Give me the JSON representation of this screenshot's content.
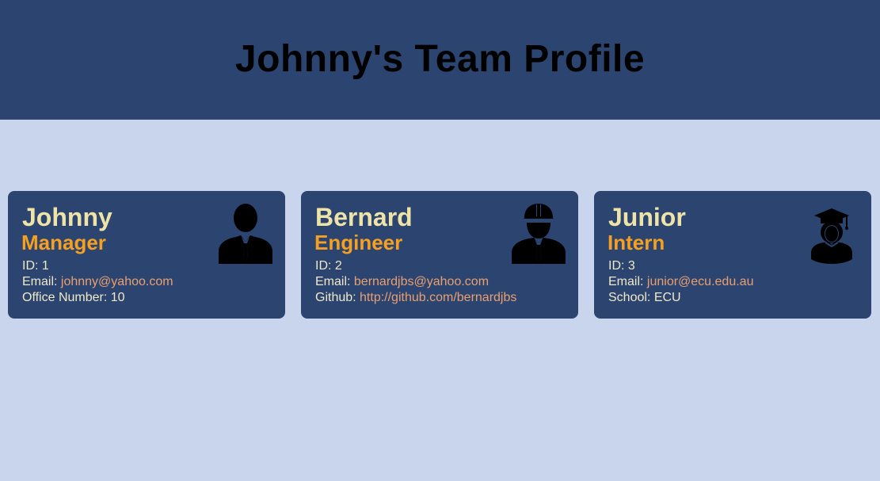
{
  "header": {
    "title": "Johnny's Team Profile"
  },
  "cards": [
    {
      "name": "Johnny",
      "role": "Manager",
      "icon": "manager-icon",
      "id_label": "ID: ",
      "id_value": "1",
      "email_label": "Email: ",
      "email_value": "johnny@yahoo.com",
      "extra_label": "Office Number: ",
      "extra_value": "10"
    },
    {
      "name": "Bernard",
      "role": "Engineer",
      "icon": "engineer-icon",
      "id_label": "ID: ",
      "id_value": "2",
      "email_label": "Email: ",
      "email_value": "bernardjbs@yahoo.com",
      "extra_label": "Github: ",
      "extra_value": "http://github.com/bernardjbs"
    },
    {
      "name": "Junior",
      "role": "Intern",
      "icon": "graduate-icon",
      "id_label": "ID: ",
      "id_value": "3",
      "email_label": "Email: ",
      "email_value": "junior@ecu.edu.au",
      "extra_label": "School: ",
      "extra_value": "ECU"
    }
  ],
  "colors": {
    "background": "#c9d5ec",
    "header": "#2c4470",
    "card": "#2c4470",
    "name": "#efe4a8",
    "role": "#f5a020",
    "link": "#e8a070"
  }
}
